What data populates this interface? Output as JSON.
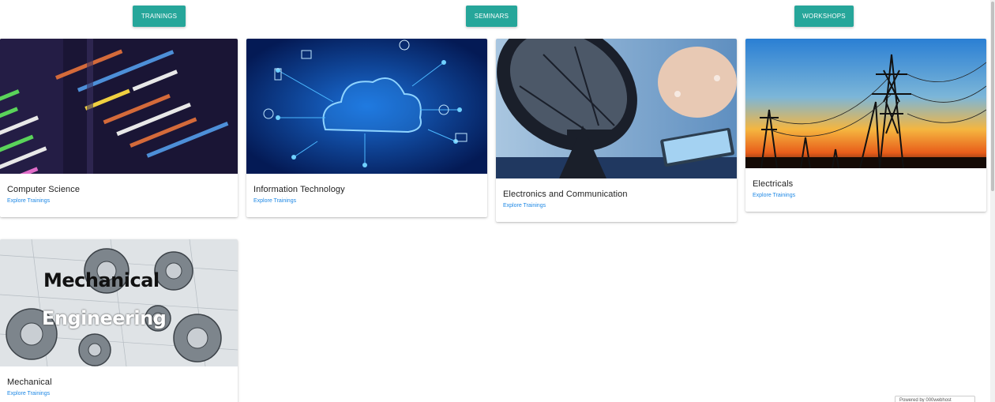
{
  "nav": {
    "trainings": "TRAININGS",
    "seminars": "SEMINARS",
    "workshops": "WORKSHOPS"
  },
  "cards": [
    {
      "title": "Computer Science",
      "link": "Explore Trainings",
      "image": "code-editor-photo"
    },
    {
      "title": "Information Technology",
      "link": "Explore Trainings",
      "image": "cloud-network-illustration"
    },
    {
      "title": "Electronics and Communication",
      "link": "Explore Trainings",
      "image": "satellite-dish-photo"
    },
    {
      "title": "Electricals",
      "link": "Explore Trainings",
      "image": "power-lines-sunset-photo"
    },
    {
      "title": "Mechanical",
      "link": "Explore Trainings",
      "image": "gears-illustration",
      "image_text": [
        "Mechanical",
        "Engineering"
      ]
    }
  ],
  "footer_badge": "Powered by 000webhost",
  "colors": {
    "accent": "#26a69a",
    "link": "#1e88e5"
  }
}
